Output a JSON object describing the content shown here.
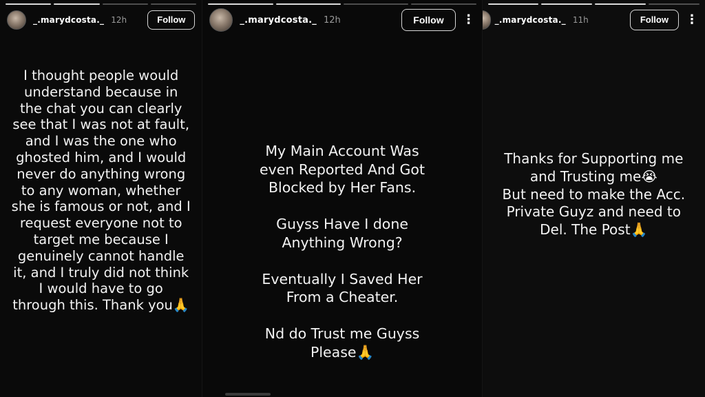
{
  "stories": [
    {
      "username": "_.marydcosta._",
      "time": "12h",
      "follow_label": "Follow",
      "text": "I thought people would\nunderstand because in\nthe chat you can clearly\nsee that I was not at fault,\nand I was the one who\nghosted him, and I would\nnever do anything wrong\nto any woman, whether\nshe is famous or not, and I\nrequest everyone not to\ntarget me because I\ngenuinely cannot handle\nit, and I truly did not think\nI would have to go\nthrough this. Thank you🙏"
    },
    {
      "username": "_.marydcosta._",
      "time": "12h",
      "follow_label": "Follow",
      "more_icon": "⋮",
      "text": "My Main Account Was\neven Reported And Got\nBlocked by Her Fans.\n\nGuyss Have I done\nAnything Wrong?\n\nEventually I Saved Her\nFrom a Cheater.\n\nNd do Trust me Guyss\nPlease🙏"
    },
    {
      "username": "_.marydcosta._",
      "time": "11h",
      "follow_label": "Follow",
      "more_icon": "⋮",
      "text": "Thanks for Supporting me\nand Trusting me😭\nBut need to make the Acc.\nPrivate Guyz and need to\nDel. The Post🙏"
    }
  ]
}
